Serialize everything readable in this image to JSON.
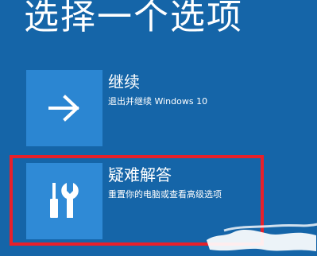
{
  "screen": {
    "title": "选择一个选项"
  },
  "options": [
    {
      "title": "继续",
      "description": "退出并继续 Windows 10",
      "icon": "arrow-right-icon"
    },
    {
      "title": "疑难解答",
      "description": "重置你的电脑或查看高级选项",
      "icon": "tools-icon"
    }
  ],
  "colors": {
    "background": "#1565a8",
    "tile": "#2f8ad6",
    "highlight": "#e8202a"
  }
}
